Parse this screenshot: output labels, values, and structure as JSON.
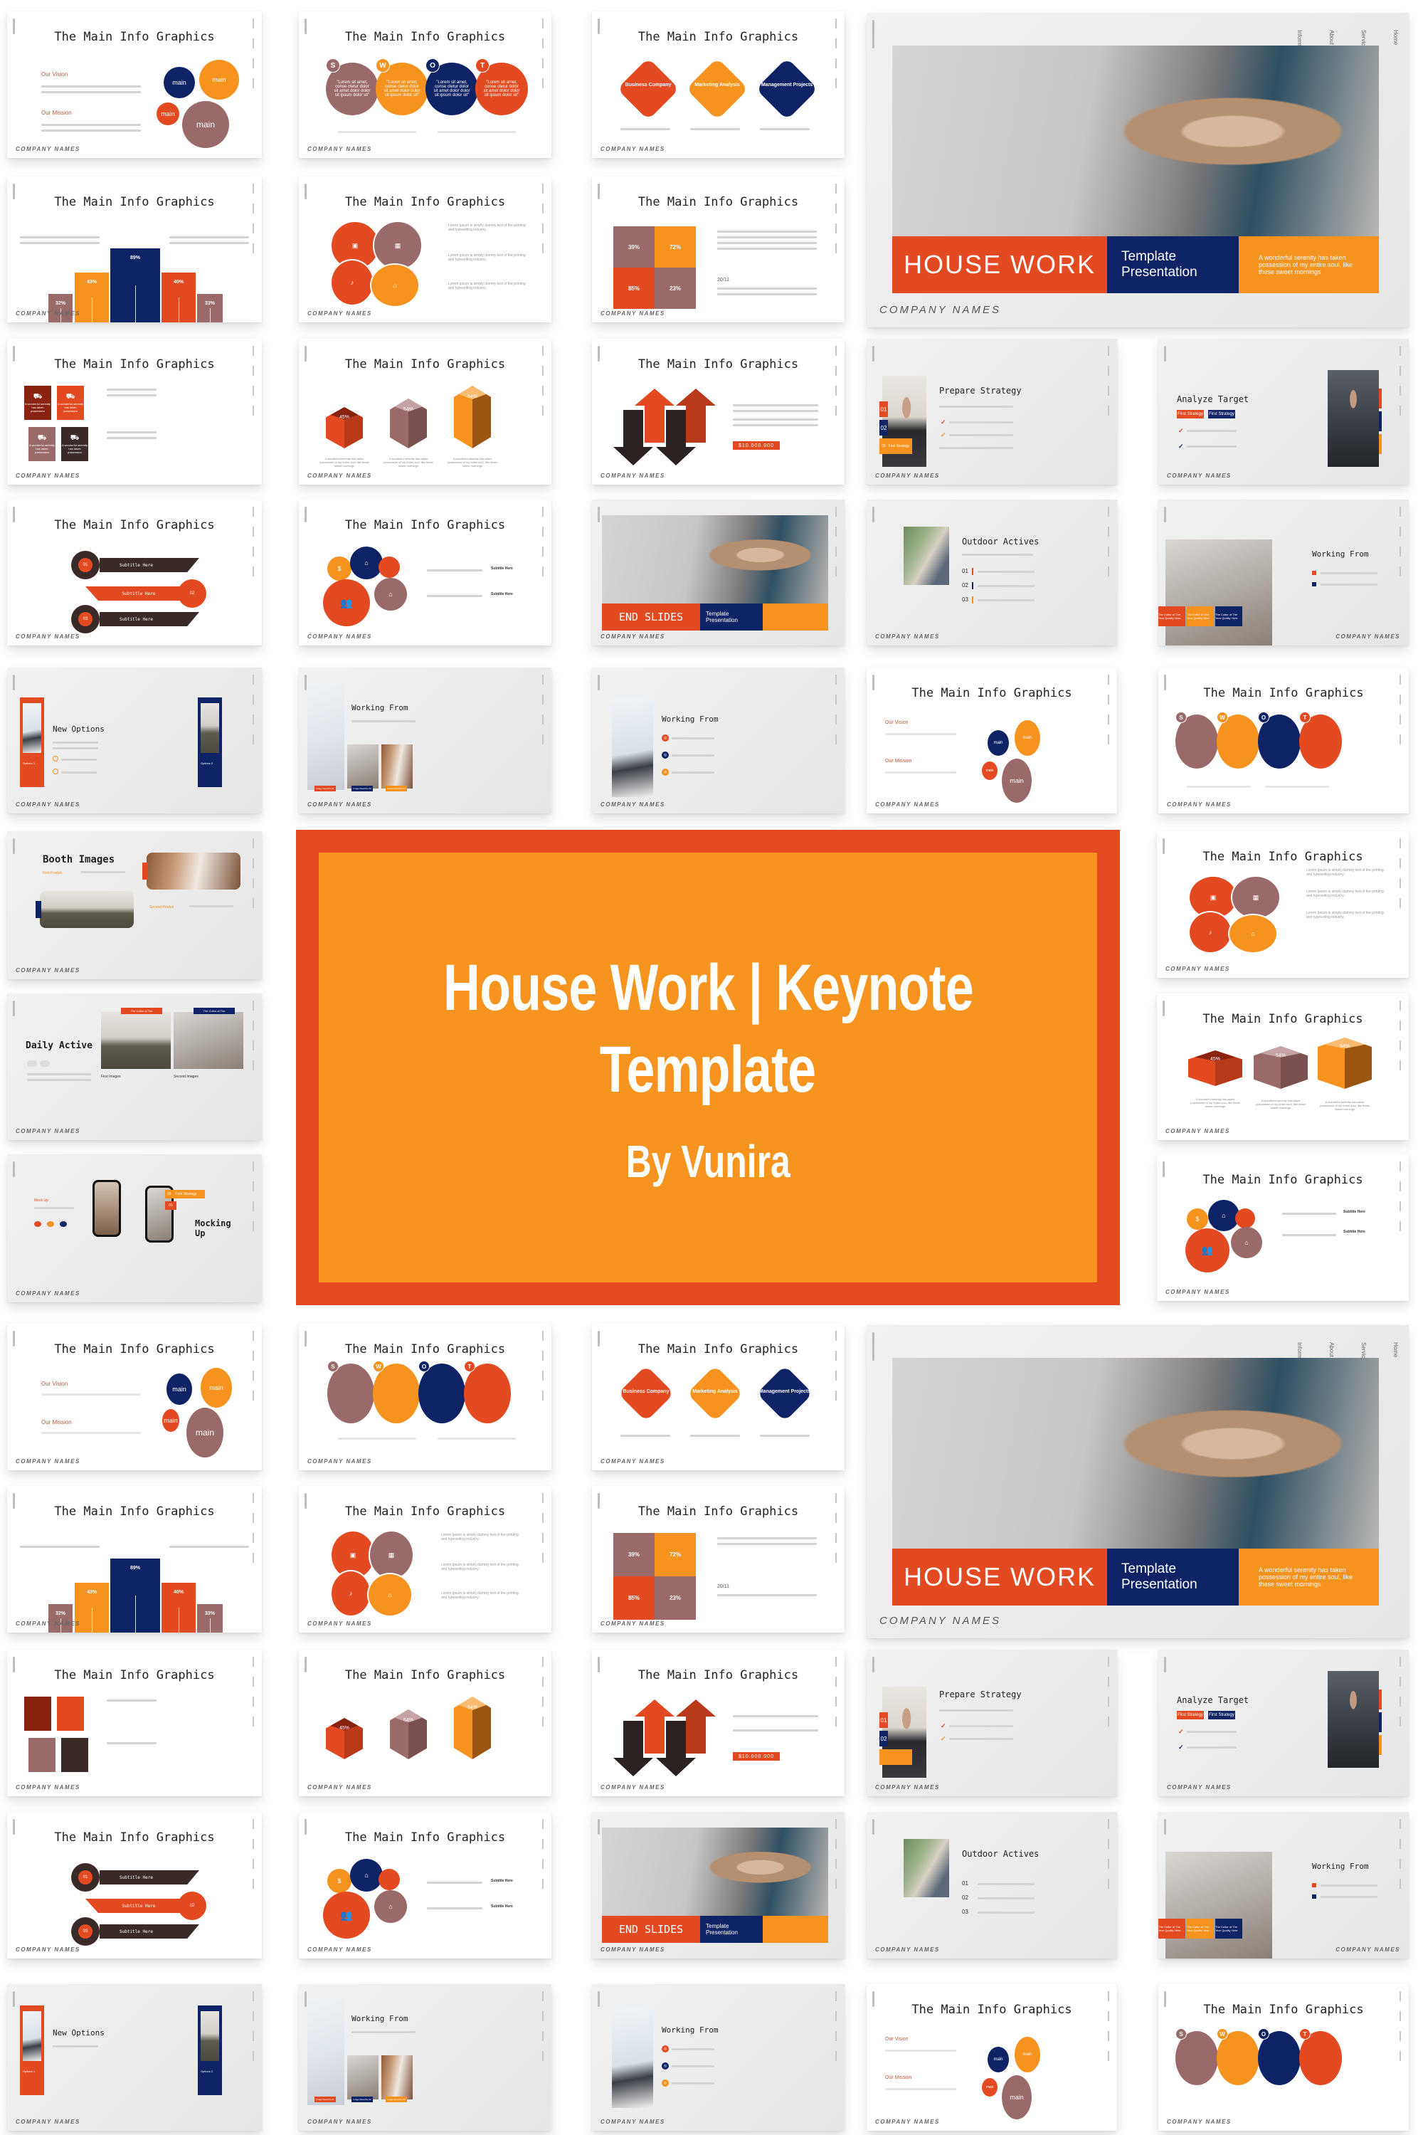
{
  "hero": {
    "title_line1": "House Work | Keynote",
    "title_line2": "Template",
    "byline": "By Vunira",
    "colors": {
      "frame": "#e54a23",
      "fill": "#f6941f",
      "text": "#ffffff"
    }
  },
  "brand_colors": {
    "orange": "#f6921e",
    "red": "#e44a21",
    "navy": "#0d2366",
    "mauve": "#9a6a6a",
    "dark": "#3a2a28"
  },
  "common": {
    "company_label": "COMPANY NAMES",
    "info_title": "The Main Info Graphics",
    "side_nav": [
      "Home",
      "Service",
      "About",
      "Information"
    ]
  },
  "slides": {
    "vision_mission": {
      "headings": [
        "Our Vision",
        "Our Mission"
      ],
      "circle_labels": [
        "main",
        "main",
        "main",
        "main"
      ]
    },
    "swot": {
      "letters": [
        "S",
        "W",
        "O",
        "T"
      ],
      "quote": "\"Lorem sit amet, conse ctetur dolor sit amet dolor dolor sit ipsum dolor sit\""
    },
    "diamonds": {
      "labels": [
        "Business Company",
        "Marketing Analysis",
        "Management Projects"
      ]
    },
    "cover": {
      "title": "HOUSE WORK",
      "subtitle": "Template Presentation",
      "tagline": "A wonderful serenity has taken possession of my entire soul, like these sweet mornings"
    },
    "bars": {
      "values": [
        "32%",
        "43%",
        "89%",
        "40%",
        "33%"
      ]
    },
    "venn": {
      "icons": [
        "presentation-icon",
        "calendar-icon",
        "saxophone-icon",
        "tag-icon"
      ],
      "bullets": [
        "Lorem Ipsum is simply dummy text of the printing and typesetting industry.",
        "Lorem Ipsum is simply dummy text of the printing and typesetting industry.",
        "Lorem Ipsum is simply dummy text of the printing and typesetting industry."
      ]
    },
    "quad": {
      "values": [
        "39%",
        "72%",
        "85%",
        "23%"
      ],
      "date": "20/11"
    },
    "trucks": {
      "caption": "A wonderful serenity has taken possession"
    },
    "cubes": {
      "values": [
        "45%",
        "54%",
        "64%"
      ],
      "caption": "A wonderful serenity has taken possession of my entire soul, like these sweet mornings"
    },
    "arrows": {
      "amount": "$10.000.000"
    },
    "prepare_strategy": {
      "title": "Prepare Strategy",
      "badges": [
        "01",
        "02",
        "03"
      ],
      "badge_label": "First Strategy"
    },
    "analyze_target": {
      "title": "Analyze Target",
      "buttons": [
        "First Strategy",
        "First Strategy"
      ]
    },
    "timeline": {
      "numbers": [
        "01",
        "02",
        "03"
      ],
      "subtitle": "Subtitle Here"
    },
    "gears": {
      "subtitle": "Subtitle Here"
    },
    "end_slides": {
      "title": "END SLIDES",
      "subtitle": "Template Presentation"
    },
    "outdoor": {
      "title": "Outdoor Actives",
      "numbers": [
        "01",
        "02",
        "03"
      ]
    },
    "working_from_1": {
      "title": "Working From",
      "tiles": [
        "The Cultur of The Year Quality Here",
        "The Cultur of The Year Quality Here",
        "The Cultur of The Year Quality Here"
      ]
    },
    "new_options": {
      "title": "New Options",
      "options": [
        "Options 1",
        "Options 2"
      ]
    },
    "working_from_2": {
      "title": "Working From",
      "tags": [
        "Image Describe 01",
        "Image Describe 02",
        "Image Describe 03"
      ]
    },
    "working_from_3": {
      "title": "Working From"
    },
    "booth": {
      "title": "Booth Images",
      "labels": [
        "First Produk",
        "Second Produk"
      ]
    },
    "daily": {
      "title": "Daily Active",
      "tags": [
        "The Cultur of The",
        "The Cultur of The"
      ],
      "captions": [
        "First Images",
        "Second Images"
      ]
    },
    "mockup": {
      "title_line1": "Mocking",
      "title_line2": "Up",
      "label": "Mock Up",
      "badge1": "03",
      "badge1_label": "First Strategy",
      "badge2": "01"
    }
  }
}
